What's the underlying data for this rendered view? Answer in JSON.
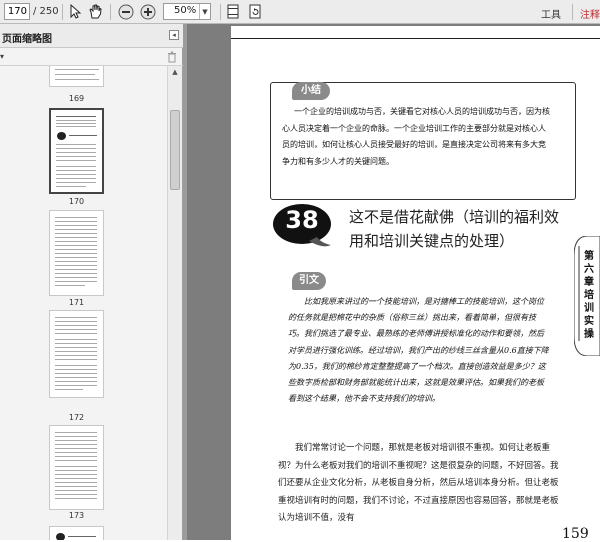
{
  "toolbar": {
    "page_current": "170",
    "page_total": "/ 250",
    "zoom": "50%",
    "tools_label": "工具",
    "comment_label": "注释"
  },
  "sidebar": {
    "title": "页面缩略图",
    "thumbnails": [
      {
        "label": "169"
      },
      {
        "label": "170"
      },
      {
        "label": "171"
      },
      {
        "label": "172"
      },
      {
        "label": "173"
      }
    ]
  },
  "document": {
    "summary_tag": "小结",
    "summary_text": "一个企业的培训成功与否，关键看它对核心人员的培训成功与否，因为核心人员决定着一个企业的命脉。一个企业培训工作的主要部分就是对核心人员的培训，如何让核心人员接受最好的培训，是直接决定公司将来有多大竞争力和有多少人才的关键问题。",
    "section_number": "38",
    "section_title": "这不是借花献佛（培训的福利效用和培训关键点的处理）",
    "intro_tag": "引文",
    "intro_text": "比如我原来讲过的一个技能培训，是对搪棒工的技能培训，这个岗位的任务就是把棉花中的杂质（俗称三丝）挑出来，看着简单，但很有技巧。我们挑选了最专业、最熟练的老师傅讲授标准化的动作和要领，然后对学员进行强化训练。经过培训，我们产出的纱线三丝含量从0.6直接下降为0.35，我们的棉纱肯定整整提高了一个档次。直接创造效益是多少？这些数字质检部和财务部就能统计出来，这就是效果评估。如果我们的老板看到这个结果，他不会不支持我们的培训。",
    "body_text": "我们常常讨论一个问题，那就是老板对培训很不重视。如何让老板重视？为什么老板对我们的培训不重视呢？这是很复杂的问题，不好回答。我们还要从企业文化分析，从老板自身分析，然后从培训本身分析。但让老板重视培训有时的问题，我们不讨论，不过直接原因也容易回答，那就是老板认为培训不值，没有",
    "chapter_label": "第六章 培训实操",
    "page_number": "159"
  }
}
